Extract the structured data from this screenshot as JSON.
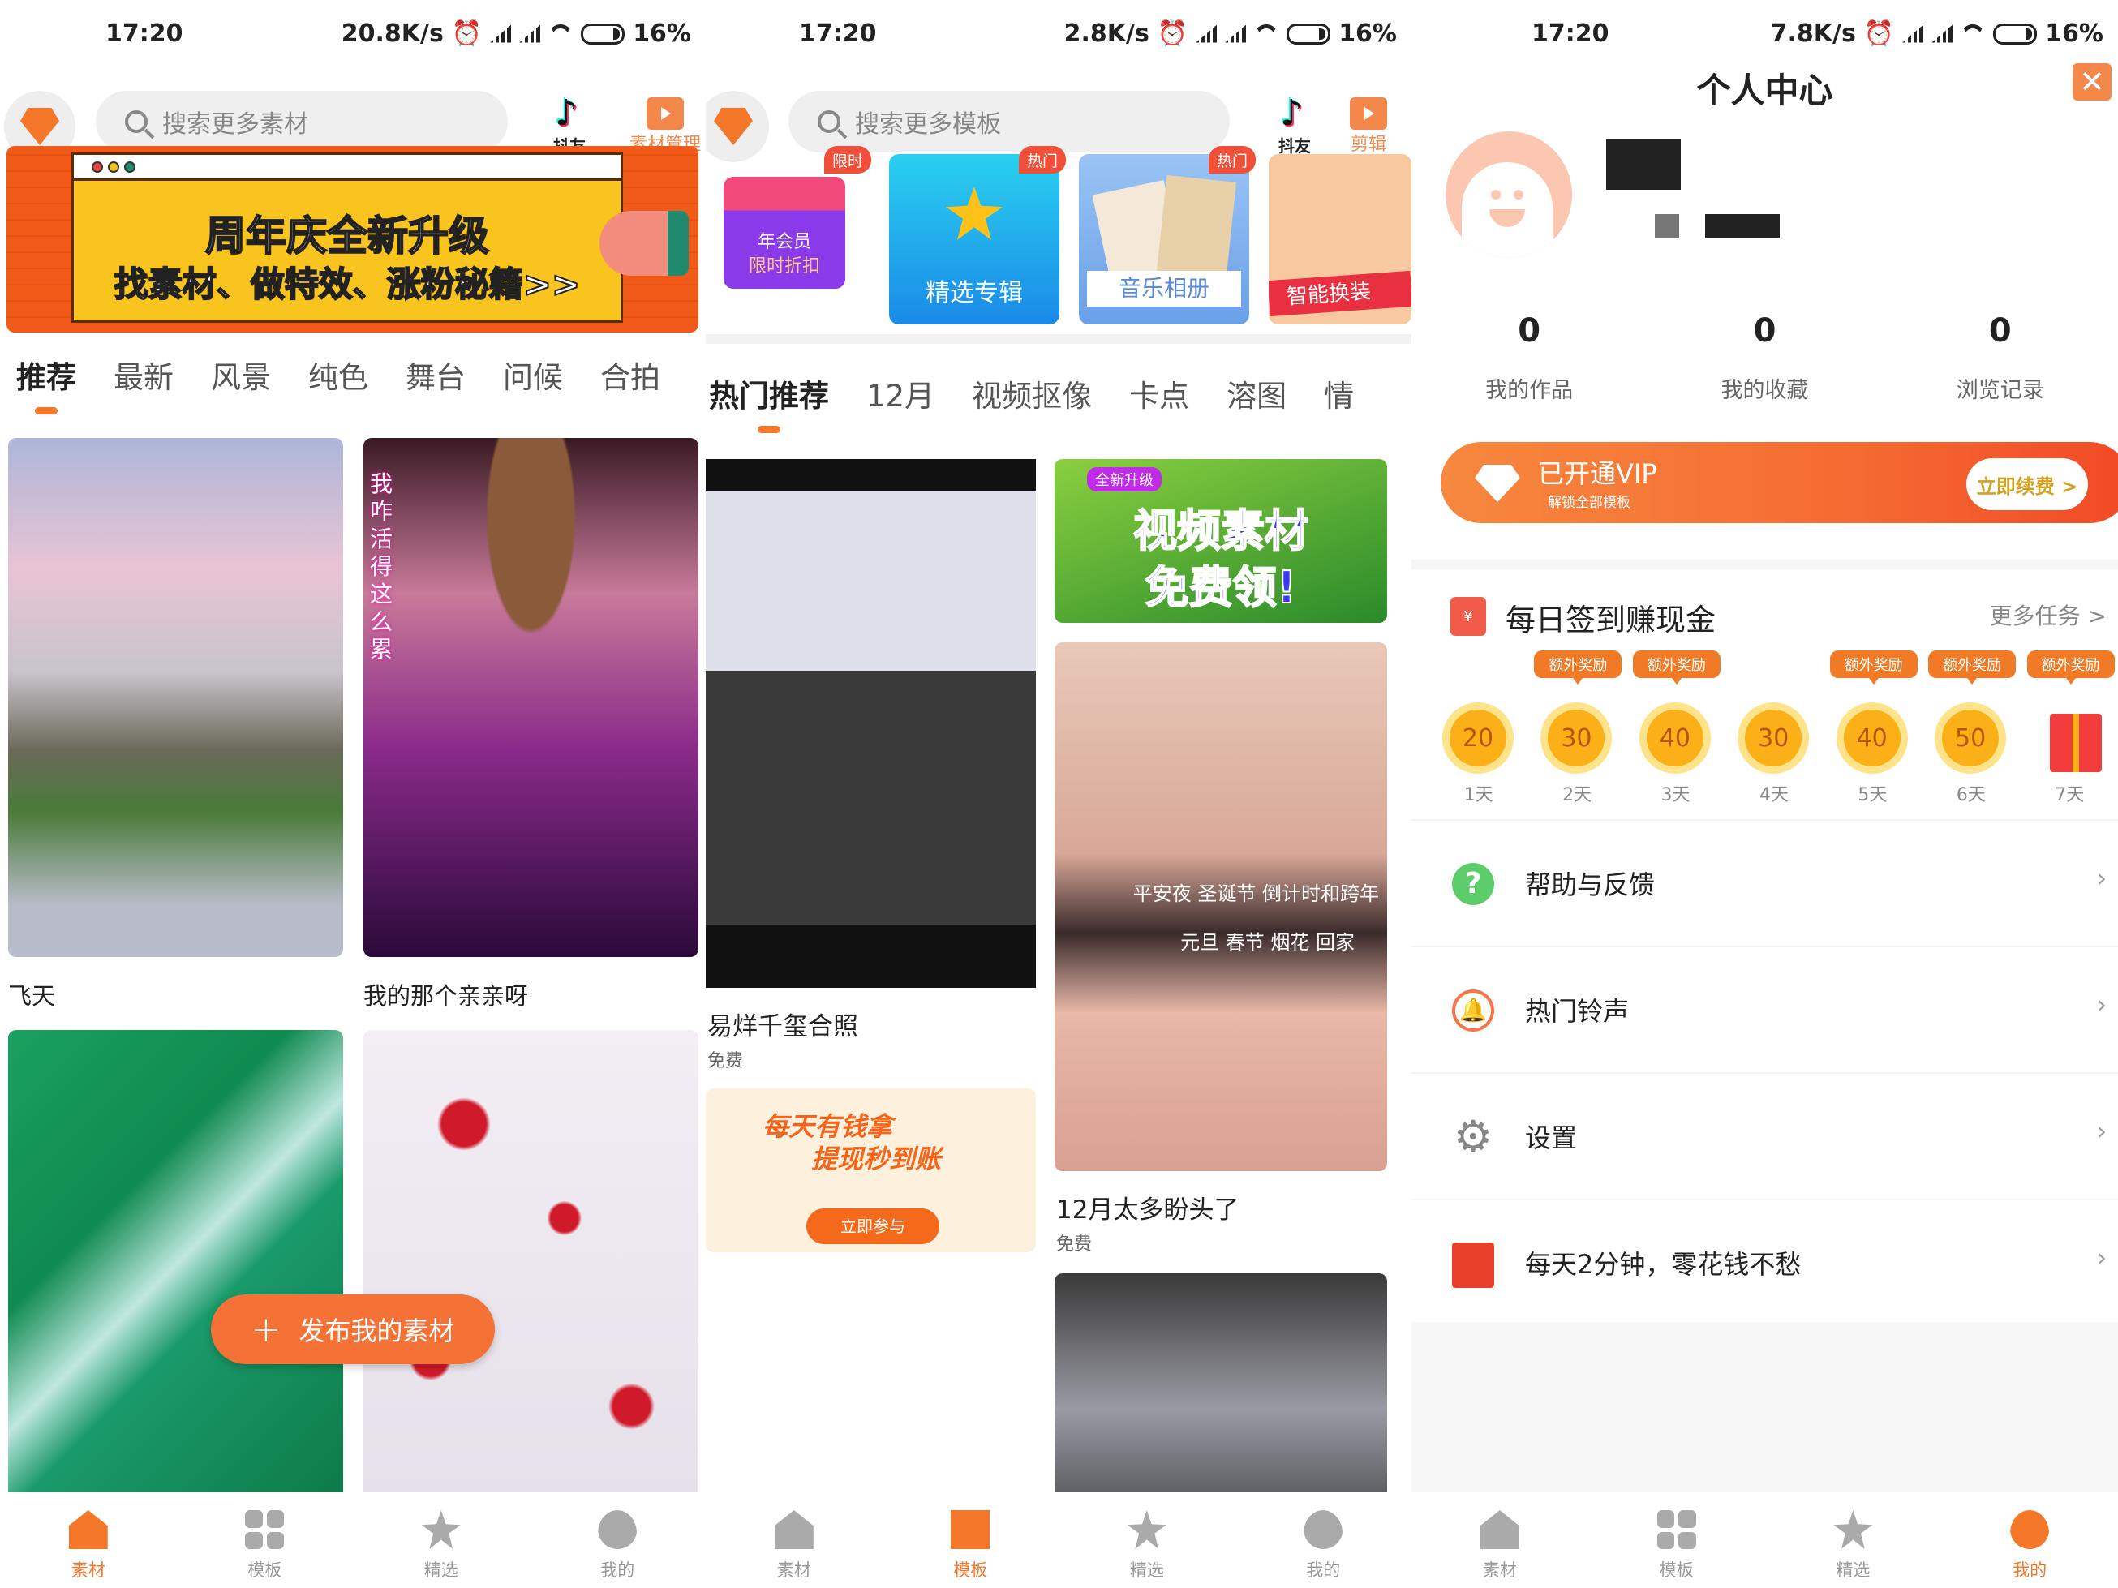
{
  "colors": {
    "accent": "#f4772a",
    "tab_inactive": "#999999",
    "vip_start": "#f7883e",
    "vip_end": "#f24a26"
  },
  "panels": [
    {
      "status": {
        "time": "17:20",
        "speed": "20.8K/s",
        "battery": "16%"
      },
      "search": {
        "placeholder": "搜索更多素材"
      },
      "header_icons": [
        {
          "icon": "tiktok-icon",
          "label": "抖友"
        },
        {
          "icon": "folder-play-icon",
          "label": "素材管理"
        }
      ],
      "banner": {
        "line1": "周年庆全新升级",
        "line2": "找素材、做特效、涨粉秘籍>>"
      },
      "tabs": [
        "推荐",
        "最新",
        "风景",
        "纯色",
        "舞台",
        "问候",
        "合拍"
      ],
      "active_tab": 0,
      "tiles": [
        {
          "title": "飞天",
          "thumb": "misty-mountain"
        },
        {
          "title": "我的那个亲亲呀",
          "thumb": "stage-lights",
          "overlay": "我咋活得这么累"
        },
        {
          "title": "",
          "thumb": "green-waterfall"
        },
        {
          "title": "",
          "thumb": "red-berries-snow"
        }
      ],
      "fab": {
        "icon": "plus-icon",
        "label": "发布我的素材"
      }
    },
    {
      "status": {
        "time": "17:20",
        "speed": "2.8K/s",
        "battery": "16%"
      },
      "search": {
        "placeholder": "搜索更多模板"
      },
      "header_icons": [
        {
          "icon": "tiktok-icon",
          "label": "抖友"
        },
        {
          "icon": "video-camera-icon",
          "label": "剪辑"
        }
      ],
      "promos": [
        {
          "tag": "限时",
          "line1": "年会员",
          "line2": "限时折扣"
        },
        {
          "tag": "热门",
          "label": "精选专辑"
        },
        {
          "tag": "热门",
          "label": "音乐相册"
        },
        {
          "tag": "",
          "label": "智能换装"
        }
      ],
      "tabs": [
        "热门推荐",
        "12月",
        "视频抠像",
        "卡点",
        "溶图",
        "情"
      ],
      "active_tab": 0,
      "cards": [
        {
          "title": "易烊千玺合照",
          "price": "免费"
        },
        {
          "ad_badge": "全新升级",
          "ad_line1": "视频素材",
          "ad_line2": "免费领!"
        },
        {
          "title": "12月太多盼头了",
          "price": "免费",
          "overlay1": "平安夜 圣诞节 倒计时和跨年",
          "overlay2": "元旦 春节 烟花 回家"
        },
        {
          "ad_line1": "每天有钱拿",
          "ad_line2": "提现秒到账",
          "ad_button": "立即参与"
        }
      ]
    },
    {
      "status": {
        "time": "17:20",
        "speed": "7.8K/s",
        "battery": "16%"
      },
      "title": "个人中心",
      "stats": [
        {
          "value": "0",
          "label": "我的作品"
        },
        {
          "value": "0",
          "label": "我的收藏"
        },
        {
          "value": "0",
          "label": "浏览记录"
        }
      ],
      "vip": {
        "title": "已开通VIP",
        "subtitle": "解锁全部模板",
        "button": "立即续费 >"
      },
      "checkin": {
        "title": "每日签到赚现金",
        "more": "更多任务 >",
        "days": [
          {
            "label": "1天",
            "value": "20",
            "bonus": ""
          },
          {
            "label": "2天",
            "value": "30",
            "bonus": "额外奖励"
          },
          {
            "label": "3天",
            "value": "40",
            "bonus": "额外奖励"
          },
          {
            "label": "4天",
            "value": "30",
            "bonus": ""
          },
          {
            "label": "5天",
            "value": "40",
            "bonus": "额外奖励"
          },
          {
            "label": "6天",
            "value": "50",
            "bonus": "额外奖励"
          },
          {
            "label": "7天",
            "value": "gift",
            "bonus": "额外奖励"
          }
        ]
      },
      "menu": [
        {
          "icon": "help-icon",
          "label": "帮助与反馈"
        },
        {
          "icon": "bell-icon",
          "label": "热门铃声"
        },
        {
          "icon": "gear-icon",
          "label": "设置"
        },
        {
          "icon": "red-envelope-icon",
          "label": "每天2分钟，零花钱不愁"
        }
      ]
    }
  ],
  "bottom_nav": [
    "素材",
    "模板",
    "精选",
    "我的"
  ],
  "bottom_nav_active": [
    0,
    1,
    3
  ]
}
